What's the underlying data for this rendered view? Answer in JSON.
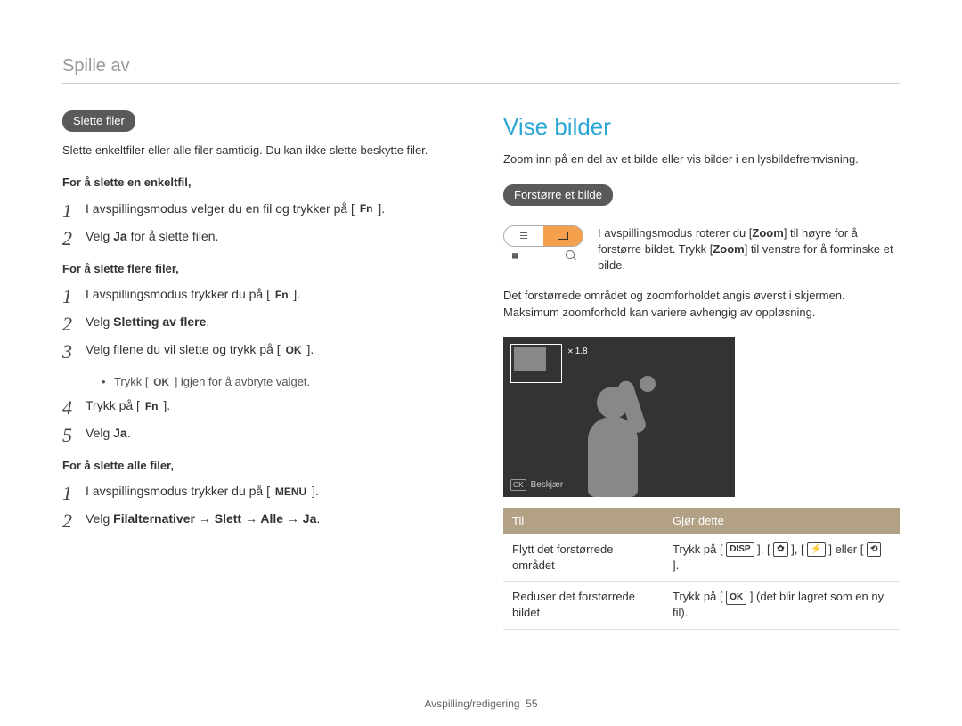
{
  "page_header": "Spille av",
  "left": {
    "pill_delete": "Slette filer",
    "intro": "Slette enkeltfiler eller alle filer samtidig. Du kan ikke slette beskytte filer.",
    "sub_single": "For å slette en enkeltfil,",
    "single_steps": {
      "s1_a": "I avspillingsmodus velger du en fil og trykker på [ ",
      "s1_btn": "Fn",
      "s1_b": " ].",
      "s2_a": "Velg ",
      "s2_bold": "Ja",
      "s2_b": " for å slette filen."
    },
    "sub_multi": "For å slette flere filer,",
    "multi_steps": {
      "s1_a": "I avspillingsmodus trykker du på [ ",
      "s1_btn": "Fn",
      "s1_b": " ].",
      "s2_a": "Velg ",
      "s2_bold": "Sletting av flere",
      "s2_b": ".",
      "s3_a": "Velg filene du vil slette og trykk på [ ",
      "s3_btn": "OK",
      "s3_b": " ].",
      "s3_bul_a": "Trykk [ ",
      "s3_bul_btn": "OK",
      "s3_bul_b": " ] igjen for å avbryte valget.",
      "s4_a": "Trykk på [ ",
      "s4_btn": "Fn",
      "s4_b": " ].",
      "s5_a": "Velg ",
      "s5_bold": "Ja",
      "s5_b": "."
    },
    "sub_all": "For å slette alle filer,",
    "all_steps": {
      "s1_a": "I avspillingsmodus trykker du på [ ",
      "s1_btn": "MENU",
      "s1_b": " ].",
      "s2_a": "Velg ",
      "s2_bold": "Filalternativer → Slett → Alle → Ja",
      "s2_b": "."
    }
  },
  "right": {
    "title": "Vise bilder",
    "intro": "Zoom inn på en del av et bilde eller vis bilder i en lysbildefremvisning.",
    "pill_zoom": "Forstørre et bilde",
    "zoom_desc_a": "I avspillingsmodus roterer du [",
    "zoom_desc_z1": "Zoom",
    "zoom_desc_b": "] til høyre for å forstørre bildet. Trykk [",
    "zoom_desc_z2": "Zoom",
    "zoom_desc_c": "] til venstre for å forminske et bilde.",
    "para2": "Det forstørrede området og zoomforholdet angis øverst i skjermen. Maksimum zoomforhold kan variere avhengig av oppløsning.",
    "zoom_label": "1.8",
    "crop_label": "Beskjær",
    "table": {
      "h1": "Til",
      "h2": "Gjør dette",
      "r1c1": "Flytt det forstørrede området",
      "r1c2_a": "Trykk på [ ",
      "r1c2_disp": "DISP",
      "r1c2_sep1": " ], [ ",
      "r1c2_i2": "✿",
      "r1c2_sep2": " ], [ ",
      "r1c2_i3": "⚡",
      "r1c2_sep3": " ] eller [ ",
      "r1c2_i4": "⟲",
      "r1c2_b": " ].",
      "r2c1": "Reduser det forstørrede bildet",
      "r2c2_a": "Trykk på [ ",
      "r2c2_btn": "OK",
      "r2c2_b": " ] (det blir lagret som en ny fil)."
    }
  },
  "footer_a": "Avspilling/redigering",
  "footer_b": "55"
}
